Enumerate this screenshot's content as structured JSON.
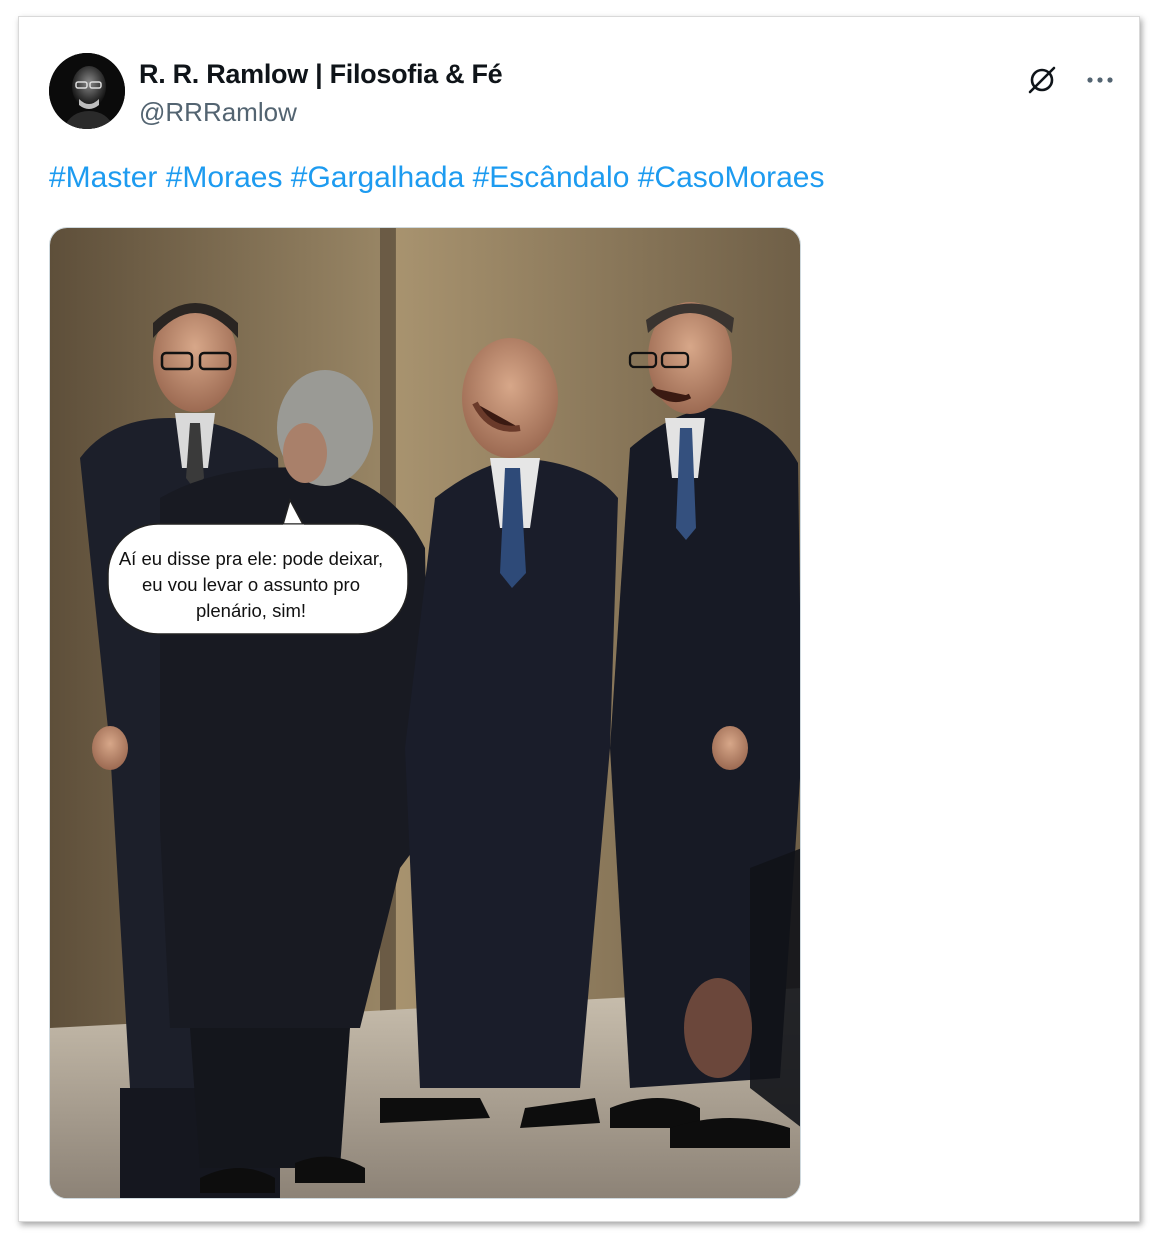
{
  "author": {
    "display_name": "R. R. Ramlow | Filosofia & Fé",
    "handle": "@RRRamlow",
    "avatar_icon": "avatar-photo"
  },
  "actions": {
    "grok_icon": "grok-icon",
    "more_icon": "more-options-icon"
  },
  "post": {
    "hashtags": [
      "#Master",
      "#Moraes",
      "#Gargalhada",
      "#Escândalo",
      "#CasoMoraes"
    ],
    "image": {
      "speech_bubble_text": "Aí eu disse pra ele: pode deixar, eu vou levar o assunto pro plenário, sim!"
    }
  },
  "colors": {
    "link": "#1d9bf0",
    "name": "#0f1419",
    "handle": "#536471"
  }
}
